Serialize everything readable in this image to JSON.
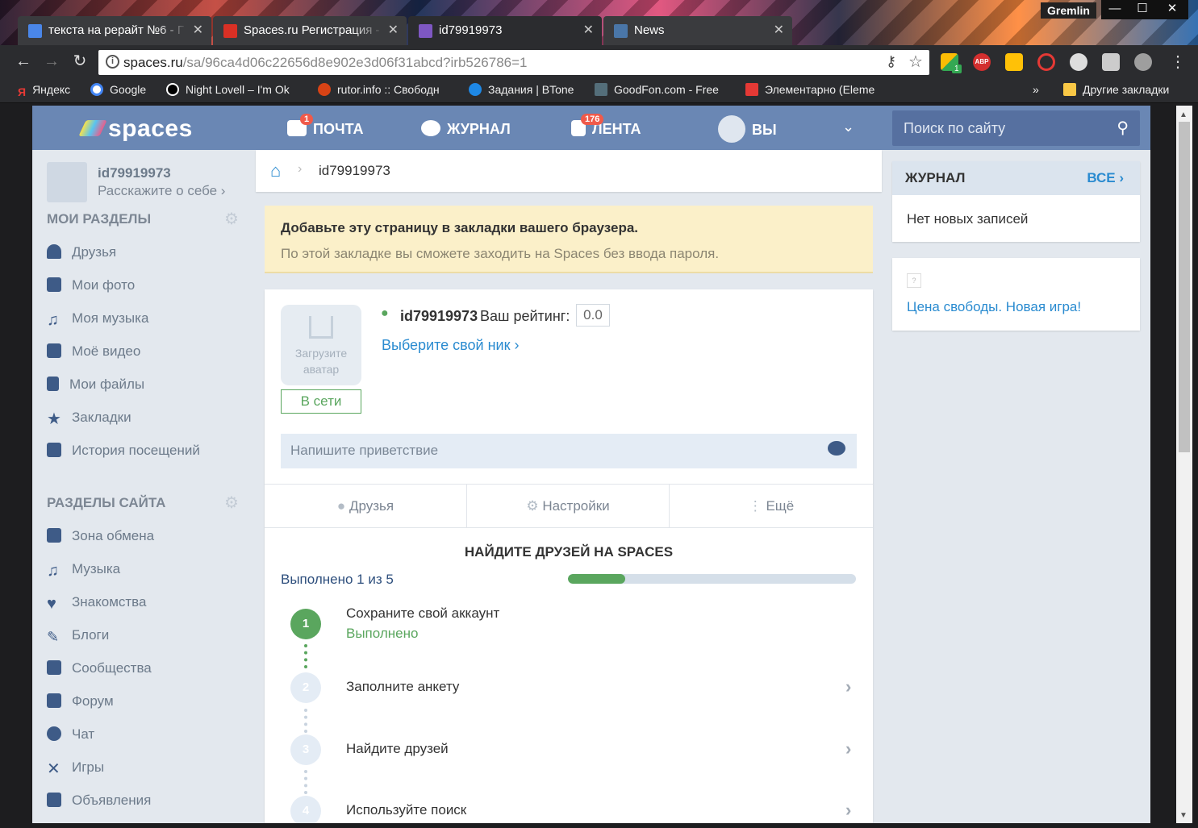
{
  "window": {
    "user": "Gremlin",
    "tabs": [
      {
        "title": "текста на рерайт №6 - Г",
        "icon": "docs-icon"
      },
      {
        "title": "Spaces.ru Регистрация -",
        "icon": "gmail-icon"
      },
      {
        "title": "id79919973",
        "icon": "spaces-icon"
      },
      {
        "title": "News",
        "icon": "vk-icon"
      }
    ]
  },
  "toolbar": {
    "url_host": "spaces.ru",
    "url_path": "/sa/96ca4d06c22656d8e902e3d06f31abcd?irb526786=1",
    "ext_badge": "1",
    "abp_label": "ABP"
  },
  "bookmarks": {
    "items": [
      "Яндекс",
      "Google",
      "Night Lovell – I'm Ok",
      "rutor.info :: Свободн",
      "Задания | BTone",
      "GoodFon.com - Free",
      "Элементарно (Eleme"
    ],
    "more": "»",
    "other": "Другие закладки"
  },
  "header": {
    "logo": "spaces",
    "mail": "ПОЧТА",
    "mail_badge": "1",
    "journal": "ЖУРНАЛ",
    "feed": "ЛЕНТА",
    "feed_badge": "176",
    "you": "ВЫ",
    "search_placeholder": "Поиск по сайту"
  },
  "sidebar": {
    "username": "id79919973",
    "about": "Расскажите о себе",
    "my_sections_title": "МОИ РАЗДЕЛЫ",
    "my_sections": [
      "Друзья",
      "Мои фото",
      "Моя музыка",
      "Моё видео",
      "Мои файлы",
      "Закладки",
      "История посещений"
    ],
    "site_sections_title": "РАЗДЕЛЫ САЙТА",
    "site_sections": [
      "Зона обмена",
      "Музыка",
      "Знакомства",
      "Блоги",
      "Сообщества",
      "Форум",
      "Чат",
      "Игры",
      "Объявления"
    ]
  },
  "breadcrumb": {
    "current": "id79919973"
  },
  "notice": {
    "title": "Добавьте эту страницу в закладки вашего браузера.",
    "text": "По этой закладке вы сможете заходить на Spaces без ввода пароля."
  },
  "profile": {
    "upload_avatar": "Загрузите аватар",
    "online": "В сети",
    "username": "id79919973",
    "rating_label": "Ваш рейтинг:",
    "rating": "0.0",
    "choose_nick": "Выберите свой ник",
    "greeting_placeholder": "Напишите приветствие",
    "tabs": [
      "Друзья",
      "Настройки",
      "Ещё"
    ]
  },
  "find_friends": {
    "title": "НАЙДИТЕ ДРУЗЕЙ НА SPACES",
    "progress_text": "Выполнено 1 из 5",
    "progress_fraction": 0.2,
    "steps": [
      {
        "num": "1",
        "title": "Сохраните свой аккаунт",
        "status": "Выполнено"
      },
      {
        "num": "2",
        "title": "Заполните анкету"
      },
      {
        "num": "3",
        "title": "Найдите друзей"
      },
      {
        "num": "4",
        "title": "Используйте поиск"
      }
    ]
  },
  "right": {
    "journal_title": "ЖУРНАЛ",
    "journal_all": "ВСЕ",
    "journal_empty": "Нет новых записей",
    "ad_link": "Цена свободы. Новая игра!"
  },
  "colors": {
    "header": "#6a87b4",
    "link": "#2a8bd0",
    "green": "#5aa65e",
    "notice_bg": "#fbf0c9"
  }
}
